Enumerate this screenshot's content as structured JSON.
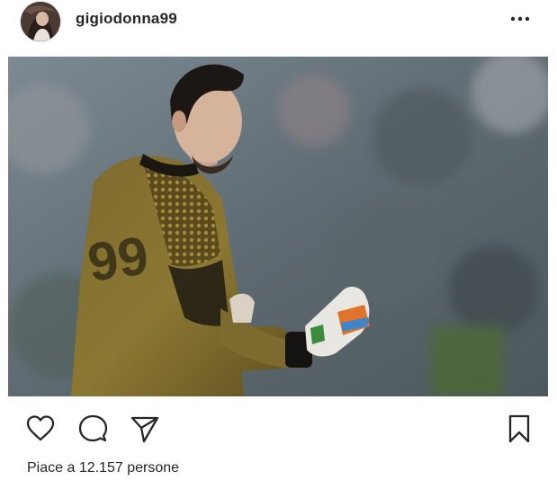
{
  "post": {
    "username": "gigiodonna99",
    "likes_text": "Piace a 12.157 persone"
  },
  "icons": {
    "more": "more-options-icon",
    "like": "heart-icon",
    "comment": "comment-icon",
    "share": "direct-share-icon",
    "save": "bookmark-icon"
  },
  "colors": {
    "text": "#262626",
    "background": "#ffffff"
  }
}
